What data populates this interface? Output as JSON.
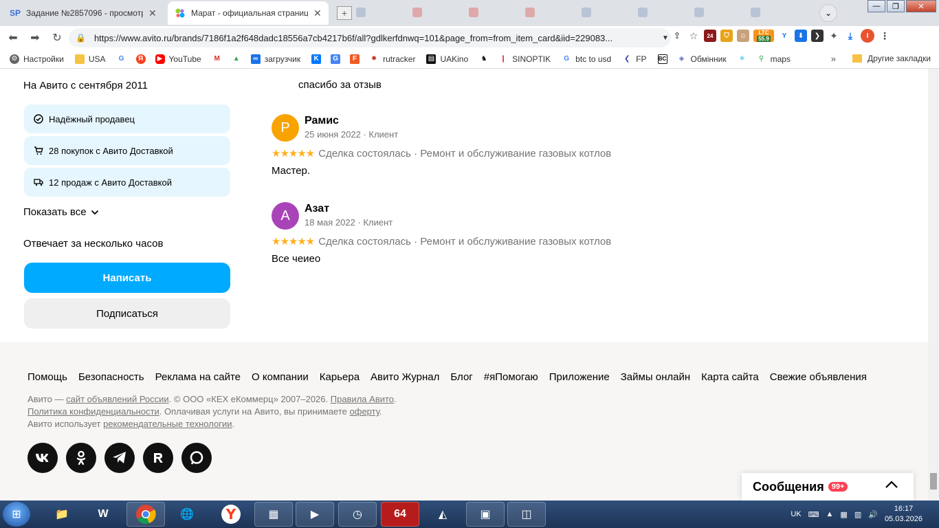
{
  "browser": {
    "tabs": [
      {
        "favicon": "SP",
        "title": "Задание №2857096 - просмотр з"
      },
      {
        "favicon": "avito",
        "title": "Марат - официальная страница"
      }
    ],
    "url": "https://www.avito.ru/brands/7186f1a2f648dadc18556a7cb4217b6f/all?gdlkerfdnwq=101&page_from=from_item_card&iid=229083...",
    "ext_ltc_label": "LTC",
    "ext_ltc_value": "55.9",
    "ext_24": "24",
    "profile_initial": "I",
    "bookmarks": [
      "Настройки",
      "USA",
      "YouTube",
      "загрузчик",
      "rutracker",
      "UAKino",
      "SINOPTIK",
      "btc to usd",
      "FP",
      "Обмінник",
      "maps"
    ],
    "more_label": "»",
    "other_bookmarks": "Другие закладки"
  },
  "seller": {
    "since": "На Авито с сентября 2011",
    "badges": [
      {
        "icon": "check-circle-icon",
        "label": "Надёжный продавец"
      },
      {
        "icon": "cart-icon",
        "label": "28 покупок с Авито Доставкой"
      },
      {
        "icon": "truck-icon",
        "label": "12 продаж с Авито Доставкой"
      }
    ],
    "show_all": "Показать все",
    "responds": "Отвечает за несколько часов",
    "write_btn": "Написать",
    "subscribe_btn": "Подписаться"
  },
  "reviews": {
    "prev_reply": "спасибо за отзыв",
    "items": [
      {
        "initial": "Р",
        "avatar_color": "#f8a300",
        "name": "Рамис",
        "meta": "25 июня 2022 · Клиент",
        "stars": "★★★★★",
        "deal": "Сделка состоялась · Ремонт и обслуживание газовых котлов",
        "text": "Мастер."
      },
      {
        "initial": "А",
        "avatar_color": "#a944b8",
        "name": "Азат",
        "meta": "18 мая 2022 · Клиент",
        "stars": "★★★★★",
        "deal": "Сделка состоялась · Ремонт и обслуживание газовых котлов",
        "text": "Все чеиео"
      }
    ]
  },
  "footer": {
    "links": [
      "Помощь",
      "Безопасность",
      "Реклама на сайте",
      "О компании",
      "Карьера",
      "Авито Журнал",
      "Блог",
      "#яПомогаю",
      "Приложение",
      "Займы онлайн",
      "Карта сайта",
      "Свежие объявления"
    ],
    "legal_1_a": "Авито — ",
    "legal_1_link": "сайт объявлений России",
    "legal_1_b": ". © ООО «КЕХ еКоммерц» 2007–2026. ",
    "legal_1_link2": "Правила Авито",
    "legal_1_c": ".",
    "legal_2_link": "Политика конфиденциальности",
    "legal_2_a": ". Оплачивая услуги на Авито, вы принимаете ",
    "legal_2_link2": "оферту",
    "legal_2_b": ".",
    "legal_3_a": "Авито использует ",
    "legal_3_link": "рекомендательные технологии",
    "legal_3_b": ".",
    "socials": [
      "vk-icon",
      "ok-icon",
      "telegram-icon",
      "rutube-icon",
      "dzen-icon"
    ]
  },
  "messages": {
    "label": "Сообщения",
    "count": "99+"
  },
  "taskbar": {
    "lang": "UK",
    "time": "16:17",
    "date": "05.03.2026",
    "app_64": "64"
  },
  "colors": {
    "avito_blue": "#00aaff",
    "badge_bg": "#e6f6fe",
    "star": "#ffb021",
    "footer_bg": "#f7f6f4"
  }
}
